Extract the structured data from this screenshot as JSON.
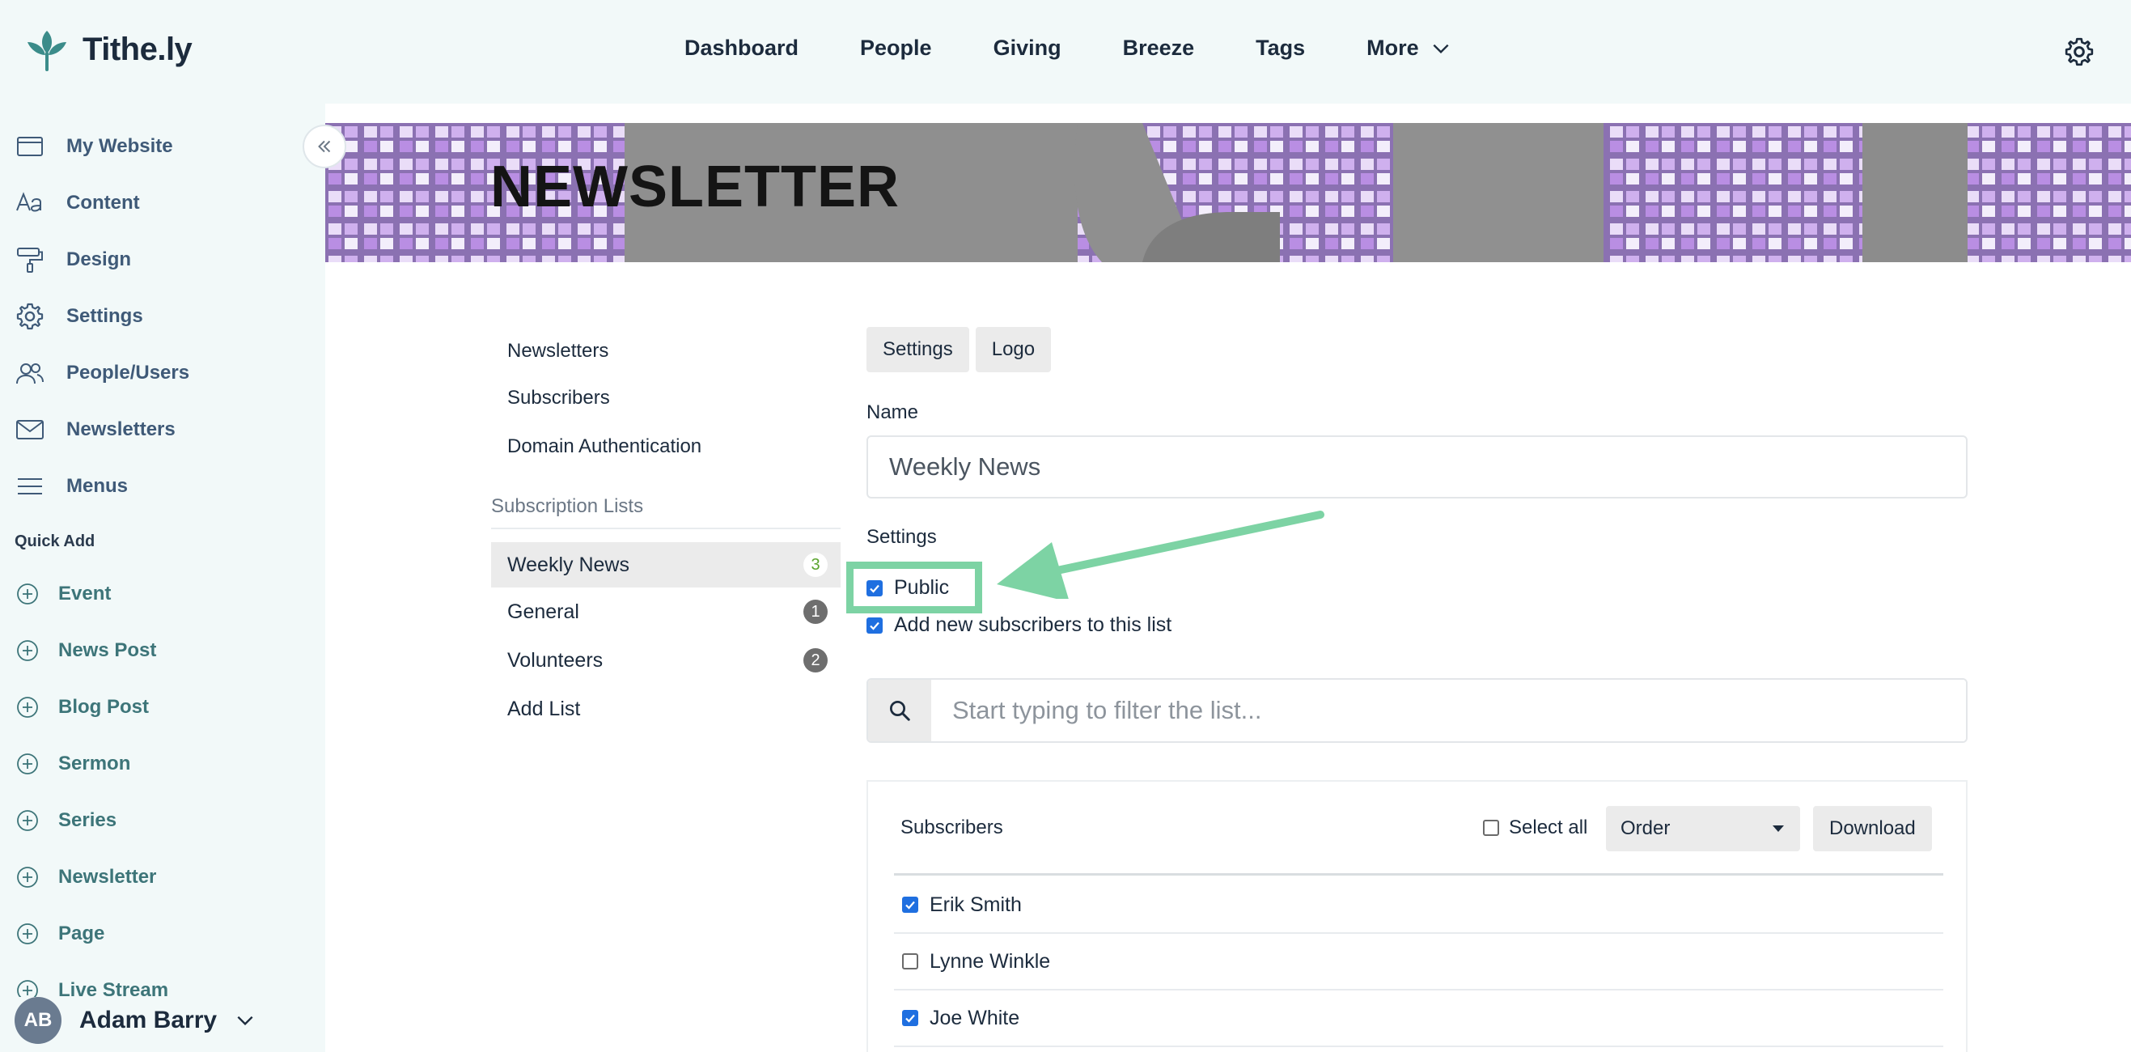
{
  "app": {
    "logo_text": "Tithe.ly"
  },
  "topnav": {
    "items": [
      "Dashboard",
      "People",
      "Giving",
      "Breeze",
      "Tags"
    ],
    "more_label": "More"
  },
  "sidebar": {
    "items": [
      "My Website",
      "Content",
      "Design",
      "Settings",
      "People/Users",
      "Newsletters",
      "Menus"
    ],
    "quick_add_label": "Quick Add",
    "quick_items": [
      "Event",
      "News Post",
      "Blog Post",
      "Sermon",
      "Series",
      "Newsletter",
      "Page",
      "Live Stream"
    ],
    "user": {
      "initials": "AB",
      "name": "Adam Barry"
    }
  },
  "banner": {
    "title": "NEWSLETTER"
  },
  "submenu": {
    "links": [
      "Newsletters",
      "Subscribers",
      "Domain Authentication"
    ],
    "lists_heading": "Subscription Lists",
    "lists": [
      {
        "label": "Weekly News",
        "count": "3"
      },
      {
        "label": "General",
        "count": "1"
      },
      {
        "label": "Volunteers",
        "count": "2"
      },
      {
        "label": "Add List"
      }
    ]
  },
  "form": {
    "tabs": [
      "Settings",
      "Logo"
    ],
    "name_label": "Name",
    "name_value": "Weekly News",
    "settings_label": "Settings",
    "public_label": "Public",
    "add_new_label": "Add new subscribers to this list",
    "search_placeholder": "Start typing to filter the list..."
  },
  "subscribers": {
    "title": "Subscribers",
    "select_all_label": "Select all",
    "order_value": "Order",
    "download_label": "Download",
    "rows": [
      {
        "name": "Erik Smith",
        "checked": true
      },
      {
        "name": "Lynne Winkle",
        "checked": false
      },
      {
        "name": "Joe White",
        "checked": true
      }
    ]
  },
  "colors": {
    "highlight": "#7dd3a4",
    "checkbox": "#1f6fe0",
    "sidebar_bg": "#f2f9f9",
    "quick_add_text": "#3d7579"
  }
}
